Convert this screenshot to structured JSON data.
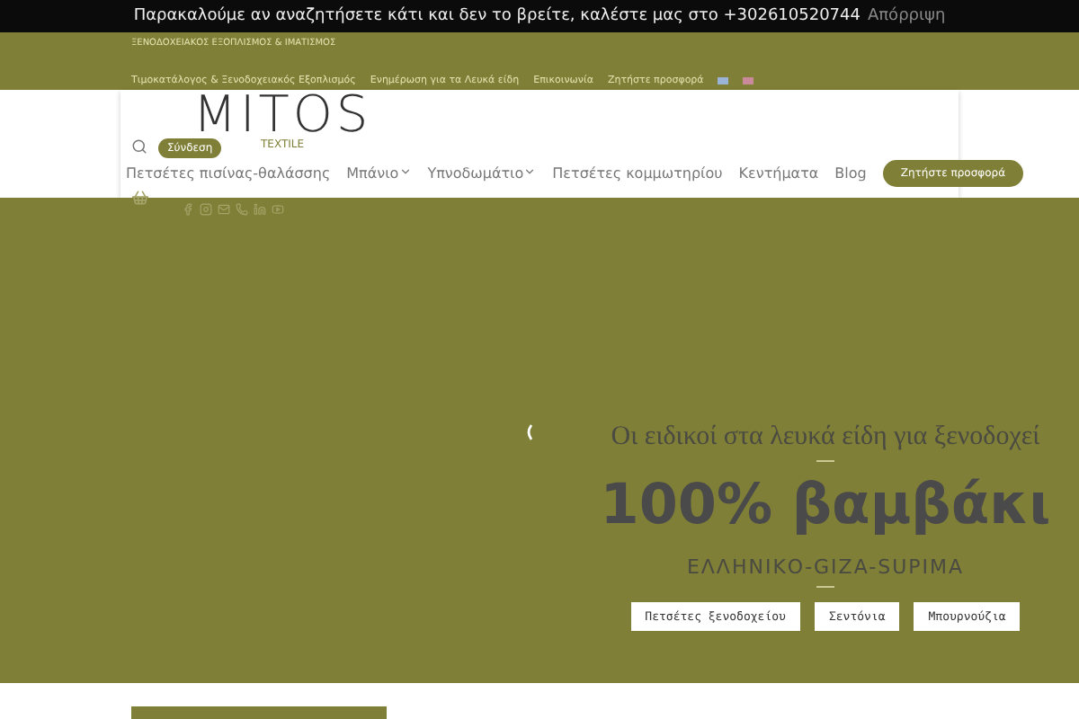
{
  "notice": {
    "text": "Παρακαλούμε αν αναζητήσετε κάτι και δεν το βρείτε, καλέστε μας στο +302610520744",
    "dismiss": "Απόρριψη"
  },
  "topbar": {
    "tagline": "ΞΕΝΟΔΟΧΕΙΑΚΟΣ ΕΞΟΠΛΙΣΜΟΣ & ΙΜΑΤΙΣΜΟΣ",
    "links": [
      "Τιμοκατάλογος & Ξενοδοχειακός Εξοπλισμός",
      "Ενημέρωση για τα Λευκά είδη",
      "Επικοινωνία",
      "Ζητήστε προσφορά"
    ]
  },
  "logo": {
    "name": "MITOS",
    "sub": "TEXTILE"
  },
  "login": "Σύνδεση",
  "nav": [
    {
      "label": "Πετσέτες πισίνας-θαλάσσης",
      "dropdown": false
    },
    {
      "label": "Μπάνιο",
      "dropdown": true
    },
    {
      "label": "Υπνοδωμάτιο",
      "dropdown": true
    },
    {
      "label": "Πετσέτες κομμωτηρίου",
      "dropdown": false
    },
    {
      "label": "Κεντήματα",
      "dropdown": false
    },
    {
      "label": "Blog",
      "dropdown": false
    }
  ],
  "quote_button": "Ζητήστε προσφορά",
  "hero": {
    "subtitle": "Οι ειδικοί στα λευκά είδη για ξενοδοχεί",
    "title": "100% βαμβάκι",
    "tagline": "ΕΛΛΗΝΙΚΟ-GIZA-SUPIMA",
    "buttons": [
      "Πετσέτες ξενοδοχείου",
      "Σεντόνια",
      "Μπουρνούζια"
    ]
  }
}
